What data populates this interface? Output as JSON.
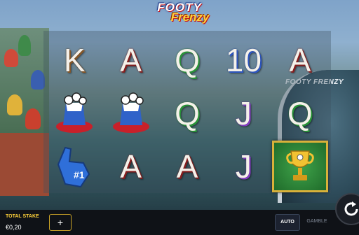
{
  "game": {
    "logo_top": "FOOTY",
    "logo_bottom": "Frenzy",
    "stadium_sign": "FOOTY FRENZY"
  },
  "reels": [
    [
      {
        "type": "letter",
        "text": "K",
        "color": "brown"
      },
      {
        "type": "icon",
        "icon": "hat-icon"
      },
      {
        "type": "icon",
        "icon": "foam-finger-icon",
        "text": "#1"
      }
    ],
    [
      {
        "type": "letter",
        "text": "A",
        "color": "red"
      },
      {
        "type": "icon",
        "icon": "hat-icon"
      },
      {
        "type": "letter",
        "text": "A",
        "color": "red"
      }
    ],
    [
      {
        "type": "letter",
        "text": "Q",
        "color": "green"
      },
      {
        "type": "letter",
        "text": "Q",
        "color": "green"
      },
      {
        "type": "letter",
        "text": "A",
        "color": "red"
      }
    ],
    [
      {
        "type": "letter",
        "text": "10",
        "color": "blue"
      },
      {
        "type": "letter",
        "text": "J",
        "color": "purple"
      },
      {
        "type": "letter",
        "text": "J",
        "color": "purple"
      }
    ],
    [
      {
        "type": "letter",
        "text": "A",
        "color": "red"
      },
      {
        "type": "letter",
        "text": "Q",
        "color": "green"
      },
      {
        "type": "icon",
        "icon": "trophy-icon"
      }
    ]
  ],
  "controls": {
    "stake_label": "TOTAL STAKE",
    "stake_value": "€0,20",
    "plus_label": "+",
    "auto_label": "AUTO",
    "gamble_label": "GAMBLE"
  },
  "colors": {
    "accent": "#ffd23a",
    "bar": "#0f1217",
    "button_border": "#c9a227"
  }
}
